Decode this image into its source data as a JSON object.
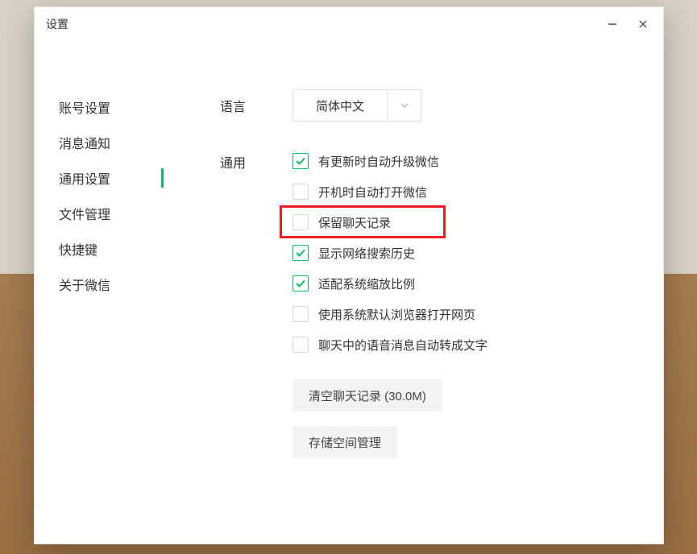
{
  "window": {
    "title": "设置"
  },
  "sidebar": {
    "items": [
      {
        "label": "账号设置"
      },
      {
        "label": "消息通知"
      },
      {
        "label": "通用设置"
      },
      {
        "label": "文件管理"
      },
      {
        "label": "快捷键"
      },
      {
        "label": "关于微信"
      }
    ],
    "activeIndex": 2
  },
  "sections": {
    "language": {
      "label": "语言",
      "selected": "简体中文"
    },
    "general": {
      "label": "通用",
      "options": [
        {
          "label": "有更新时自动升级微信",
          "checked": true
        },
        {
          "label": "开机时自动打开微信",
          "checked": false
        },
        {
          "label": "保留聊天记录",
          "checked": false,
          "highlighted": true
        },
        {
          "label": "显示网络搜索历史",
          "checked": true
        },
        {
          "label": "适配系统缩放比例",
          "checked": true
        },
        {
          "label": "使用系统默认浏览器打开网页",
          "checked": false
        },
        {
          "label": "聊天中的语音消息自动转成文字",
          "checked": false
        }
      ],
      "buttons": {
        "clearHistory": "清空聊天记录 (30.0M)",
        "storageManage": "存储空间管理"
      }
    }
  }
}
